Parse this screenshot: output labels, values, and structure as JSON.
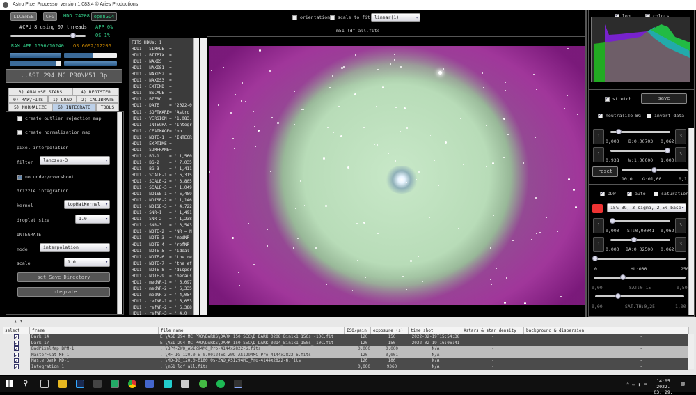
{
  "window": {
    "title": "Astro Pixel Processor version 1.083.4 © Aries Productions"
  },
  "top_left": {
    "license": "LICENSE",
    "cfg": "CFG",
    "hdd": "HDD 74208",
    "opengl": "openGL4",
    "cpu": "#CPU 8  using 07 threads",
    "app_pct": "APP 0%",
    "os_pct": "OS 1%",
    "ram_app": "RAM  APP 1596/10240",
    "ram_os": "OS 6692/12206",
    "path_button": "..ASI 294 MC PRO\\M51 3p"
  },
  "tabs": [
    "3) ANALYSE STARS",
    "4) REGISTER",
    "0) RAW/FITS",
    "1) LOAD",
    "2) CALIBRATE",
    "5) NORMALIZE",
    "6) INTEGRATE",
    "TOOLS"
  ],
  "integrate_panel": {
    "outlier_map": "create outlier rejection map",
    "norm_map": "create normalization map",
    "pixel_interp": "pixel interpolation",
    "filter_label": "filter",
    "filter_value": "lanczos-3",
    "no_overshoot": "no under/overshoot",
    "drizzle": "drizzle integration",
    "kernel_label": "kernel",
    "kernel_value": "topHatKernel",
    "droplet_label": "droplet size",
    "droplet_value": "1.0",
    "integrate_heading": "INTEGRATE",
    "mode_label": "mode",
    "mode_value": "interpolation",
    "scale_label": "scale",
    "scale_value": "1.0",
    "save_dir": "set Save Directory",
    "integrate_btn": "integrate"
  },
  "fits_header": [
    "FITS HDUs: 1",
    "HDU1 - SIMPLE  =",
    "HDU1 - BITPIX  =",
    "HDU1 - NAXIS   =",
    "HDU1 - NAXIS1  =",
    "HDU1 - NAXIS2  =",
    "HDU1 - NAXIS3  =",
    "HDU1 - EXTEND  =",
    "HDU1 - BSCALE  =",
    "HDU1 - BZERO   =",
    "HDU1 - DATE    = '2022-0",
    "HDU1 - SOFTWARE= 'Astro",
    "HDU1 - VERSION = '1.083.",
    "HDU1 - INTEGRAT= 'Integr",
    "HDU1 - CFAIMAGE= 'no",
    "HDU1 - NOTE-1  = 'INTEGR",
    "HDU1 - EXPTIME =",
    "HDU1 - SUMFRAME=",
    "HDU1 - BG-1    = ' 1,560",
    "HDU1 - BG-2    = ' 7,035",
    "HDU1 - BG-3    = ' 1,411",
    "HDU1 - SCALE-1 = ' 6,315",
    "HDU1 - SCALE-2 = ' 3,805",
    "HDU1 - SCALE-3 = ' 1,049",
    "HDU1 - NOISE-1 = ' 6,489",
    "HDU1 - NOISE-2 = ' 1,146",
    "HDU1 - NOISE-3 = ' 4,722",
    "HDU1 - SNR-1   = ' 1,491",
    "HDU1 - SNR-2   = ' 1,238",
    "HDU1 - SNR-3   = ' 3,543",
    "HDU1 - NOTE-2  = 'NR = N",
    "HDU1 - NOTE-3  = 'medNR",
    "HDU1 - NOTE-4  = 'refNR",
    "HDU1 - NOTE-5  = 'ideal",
    "HDU1 - NOTE-6  = 'the re",
    "HDU1 - NOTE-7  = 'the ef",
    "HDU1 - NOTE-8  = 'disper",
    "HDU1 - NOTE-9  = 'becaus",
    "HDU1 - medNR-1 = ' 6,097",
    "HDU1 - medNR-2 = ' 6,335",
    "HDU1 - medNR-3 = ' 4,054",
    "HDU1 - refNR-1 = ' 6,053",
    "HDU1 - refNR-2 = ' 6,388",
    "HDU1 - refNR-3 = ' 4,0"
  ],
  "viewer": {
    "orientation": "orientation",
    "scale_to_fit": "scale to fit",
    "stretch_mode": "linear(1)",
    "filename": "m51_ldf_all.fits"
  },
  "right_panel": {
    "log": "log",
    "colors": "colors",
    "stretch": "stretch",
    "save": "save",
    "neutralize": "neutralize-BG",
    "invert": "invert data",
    "b_min": "0,000",
    "b_val": "B:0,00703",
    "b_max": "0,062",
    "w_min": "0,938",
    "w_val": "W:1,00000",
    "w_max": "1,000",
    "reset": "reset",
    "g_min": "10,0",
    "g_val": "G:01,00",
    "g_max": "0,1",
    "ddp": "DDP",
    "auto": "auto",
    "saturation": "saturation",
    "preset": "15% BG, 3 sigma, 2,5% base",
    "st_min": "0,000",
    "st_val": "ST:0,00041",
    "st_max": "0,062",
    "ba_min": "0,000",
    "ba_val": "BA:0,02500",
    "ba_max": "0,062",
    "hl_min": "0",
    "hl_val": "HL:000",
    "hl_max": "250",
    "sat_min": "0,00",
    "sat_val": "SAT:0,15",
    "sat_max": "0,50",
    "satth_min": "0,00",
    "satth_val": "SAT.TH:0,25",
    "satth_max": "1,00",
    "btn_1": "1",
    "btn_3": "3"
  },
  "table": {
    "headers": [
      "select",
      "frame",
      "file name",
      "ISO/gain",
      "exposure (s)",
      "time shot",
      "#stars & star density",
      "background & dispersion"
    ],
    "rows": [
      {
        "frame": "Dark 14",
        "file": "E:\\ASI 294 MC PRO\\DARKS\\DARK 150 SEC\\D_DARK_0208_Bin1x1_150s_-10C.fit",
        "iso": "120",
        "exp": "150",
        "time": "2022-02-19T15:54:38",
        "stars": "-",
        "bg": "-",
        "style": "dark"
      },
      {
        "frame": "Dark 17",
        "file": "E:\\ASI 294 MC PRO\\DARKS\\DARK 150 SEC\\D_DARK_0214_Bin1x1_150s_-10C.fit",
        "iso": "120",
        "exp": "150",
        "time": "2022-02-19T16:06:41",
        "stars": "-",
        "bg": "-",
        "style": "dark"
      },
      {
        "frame": "BadPixelMap  BPM-1",
        "file": "..\\BPM-ZWO_ASI294MC_Pro-4144x2822-6.fits",
        "iso": "0,000",
        "exp": "0,000",
        "time": "N/A",
        "stars": "-",
        "bg": "-",
        "style": "light"
      },
      {
        "frame": "MasterFlat  MF-1",
        "file": "..\\MF-IG_120.0-E_0.001246s-ZWO_ASI294MC_Pro-4144x2822-6.fits",
        "iso": "120",
        "exp": "0,001",
        "time": "N/A",
        "stars": "-",
        "bg": "-",
        "style": "light"
      },
      {
        "frame": "MasterDark  MD-1",
        "file": "..\\MD-IG_120.0-E180.0s-ZWO_ASI294MC_Pro-4144x2822-6.fits",
        "iso": "120",
        "exp": "180",
        "time": "N/A",
        "stars": "-",
        "bg": "-",
        "style": "dark"
      },
      {
        "frame": "Integration 1",
        "file": "..\\m51_ldf_all.fits",
        "iso": "0,000",
        "exp": "9360",
        "time": "N/A",
        "stars": "-",
        "bg": "-",
        "style": "dark"
      }
    ]
  },
  "taskbar": {
    "time": "14:05",
    "date": "2022. 03. 29."
  },
  "colors": {
    "accent_green": "#33cc88",
    "panel_bg": "#000000",
    "fits_bg": "#3b3b3b"
  }
}
